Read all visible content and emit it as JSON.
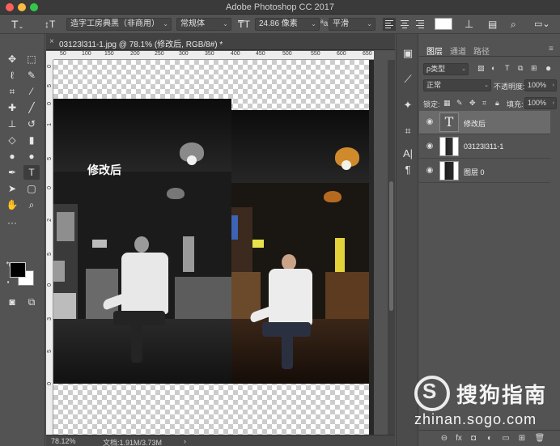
{
  "window": {
    "title": "Adobe Photoshop CC 2017"
  },
  "options_bar": {
    "tool_icon": "type-tool-icon",
    "font_family": "造字工房典黑（非商用）",
    "font_style": "常规体",
    "font_size": "24.86 像素",
    "anti_alias": "平滑",
    "text_color": "#ffffff"
  },
  "document": {
    "tab_label": "03123l311-1.jpg @ 78.1% (修改后, RGB/8#) *",
    "text_layer_text": "修改后",
    "ruler_top_labels": [
      "50",
      "100",
      "150",
      "200",
      "250",
      "300",
      "350",
      "400",
      "450",
      "500",
      "550",
      "600",
      "650"
    ],
    "ruler_left_labels": [
      "0",
      "5",
      "0",
      "1",
      "5",
      "0",
      "2",
      "5",
      "0",
      "3",
      "5",
      "0"
    ],
    "zoom": "78.12%",
    "doc_info": "文档:1.91M/3.73M"
  },
  "layers_panel": {
    "tabs": [
      "图层",
      "通道",
      "路径"
    ],
    "filter": "ρ类型",
    "blend_mode": "正常",
    "opacity_label": "不透明度:",
    "opacity": "100%",
    "lock_label": "锁定:",
    "fill_label": "填充:",
    "fill": "100%",
    "layers": [
      {
        "name": "修改后",
        "kind": "text"
      },
      {
        "name": "03123l311-1",
        "kind": "image"
      },
      {
        "name": "图层 0",
        "kind": "image"
      }
    ]
  },
  "watermark": {
    "logo_letter": "S",
    "title": "搜狗指南",
    "url": "zhinan.sogo.com"
  },
  "colors": {
    "ui_bg": "#535353",
    "titlebar": "#3a3a3a",
    "selected_layer": "#6b6b6b"
  }
}
